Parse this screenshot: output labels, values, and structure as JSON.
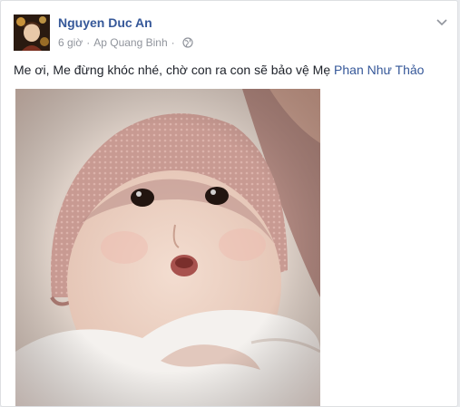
{
  "post": {
    "author": "Nguyen Duc An",
    "time": "6 giờ",
    "separator": "·",
    "location": "Ap Quang Binh",
    "message": "Me ơi, Me đừng khóc nhé, chờ con ra con sẽ bảo vệ Mẹ ",
    "tag": "Phan Như Thảo"
  },
  "icons": {
    "avatar": "avatar-image",
    "privacy": "globe-icon",
    "menu": "chevron-down-icon"
  },
  "colors": {
    "link": "#365899",
    "meta": "#90949c",
    "text": "#1d2129"
  }
}
